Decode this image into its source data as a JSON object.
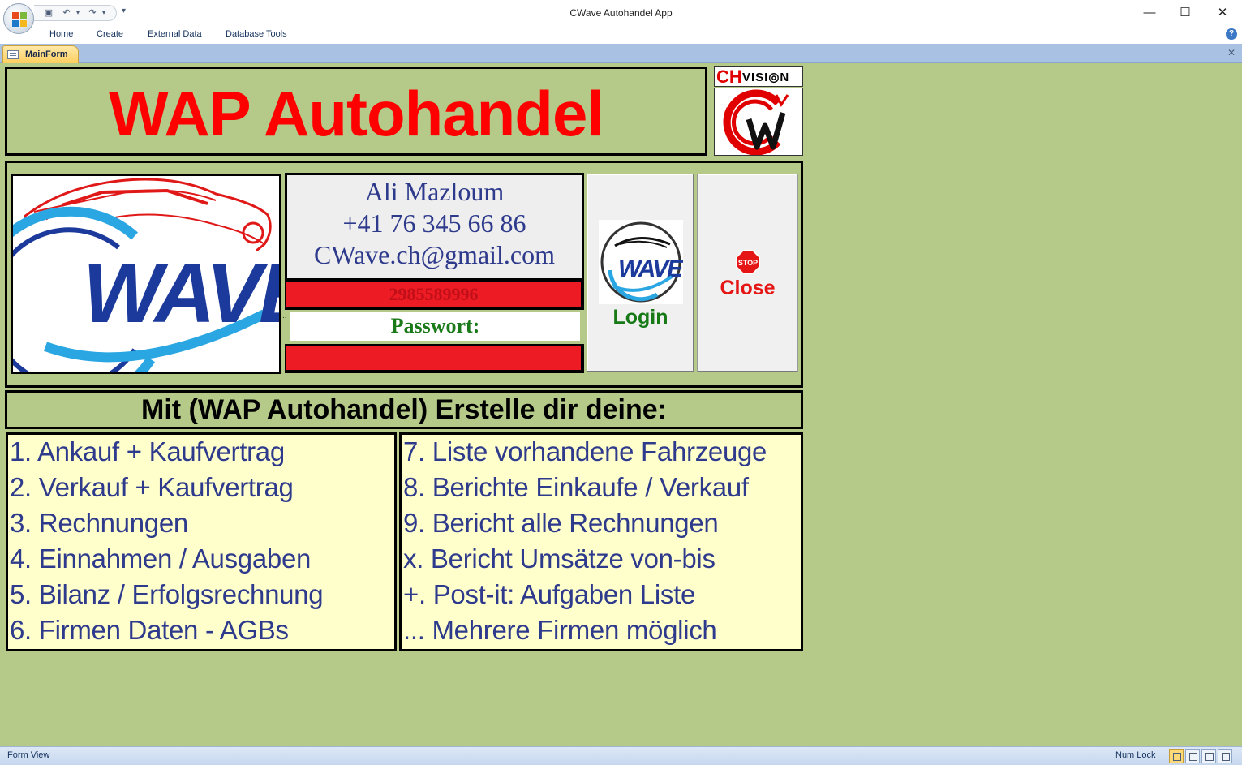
{
  "window": {
    "title": "CWave Autohandel App",
    "minimize_glyph": "—",
    "maximize_glyph": "☐",
    "close_glyph": "✕"
  },
  "quick_access": {
    "save_icon": "save-icon",
    "undo_icon": "undo-icon",
    "redo_icon": "redo-icon",
    "customize_glyph": "▾"
  },
  "ribbon": {
    "tabs": [
      "Home",
      "Create",
      "External Data",
      "Database Tools"
    ],
    "help_glyph": "?"
  },
  "document_tab": {
    "label": "MainForm",
    "close_glyph": "✕"
  },
  "form": {
    "title": "WAP Autohandel",
    "brand": {
      "ch": "CH",
      "vision": "VISI◎N"
    },
    "contact": {
      "name": "Ali Mazloum",
      "phone": "+41 76 345 66 86",
      "email": "CWave.ch@gmail.com"
    },
    "user_field_value": "2985589996",
    "password_label": "Passwort:",
    "password_value": "",
    "dots": "..",
    "login_label": "Login",
    "stop_text": "STOP",
    "close_label": "Close",
    "subtitle": "Mit (WAP Autohandel) Erstelle dir deine:",
    "features_left": [
      "1. Ankauf + Kaufvertrag",
      "2. Verkauf + Kaufvertrag",
      "3. Rechnungen",
      "4. Einnahmen / Ausgaben",
      "5. Bilanz / Erfolgsrechnung",
      "6. Firmen Daten - AGBs"
    ],
    "features_right": [
      "7. Liste vorhandene Fahrzeuge",
      "8. Berichte Einkaufe / Verkauf",
      "9. Bericht alle Rechnungen",
      "x. Bericht Umsätze von-bis",
      "+. Post-it: Aufgaben Liste",
      "... Mehrere Firmen möglich"
    ],
    "colors": {
      "background": "#b5ca88",
      "title_red": "#ff0000",
      "field_red": "#ed1c24",
      "list_bg": "#ffffcc",
      "list_text": "#2e3a8c",
      "login_green": "#177a17"
    }
  },
  "statusbar": {
    "view_label": "Form View",
    "numlock": "Num Lock"
  }
}
